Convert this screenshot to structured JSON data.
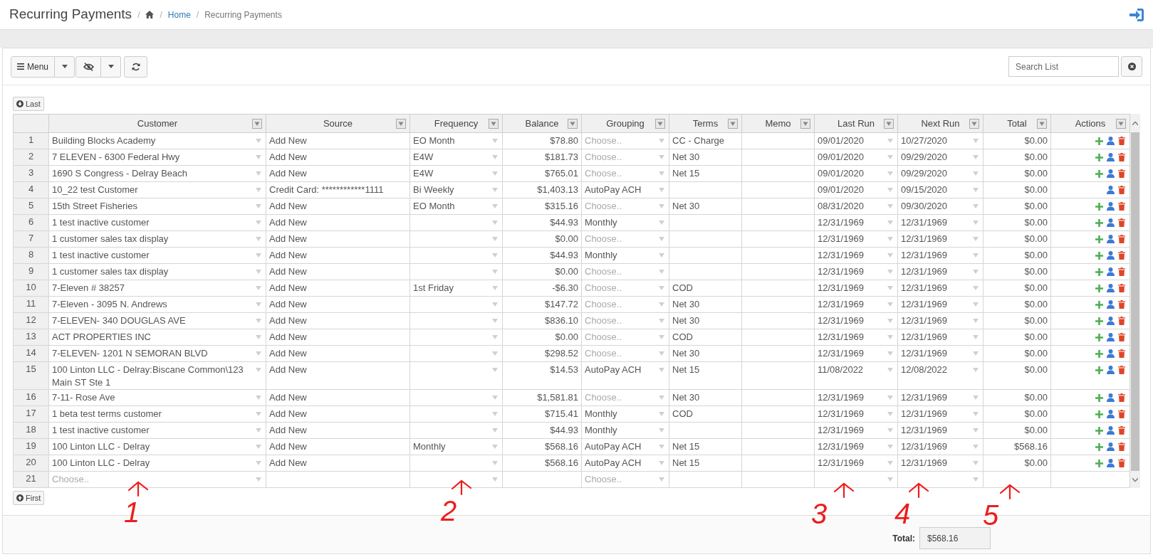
{
  "page": {
    "title": "Recurring Payments",
    "breadcrumb": [
      "Home",
      "Recurring Payments"
    ],
    "separators": [
      "/",
      "/",
      "/"
    ]
  },
  "toolbar": {
    "menu_label": "Menu",
    "search": {
      "placeholder": "Search List"
    }
  },
  "nav_top": "Last",
  "nav_bottom": "First",
  "table": {
    "columns": [
      "Customer",
      "Source",
      "Frequency",
      "Balance",
      "Grouping",
      "Terms",
      "Memo",
      "Last Run",
      "Next Run",
      "Total",
      "Actions"
    ],
    "rows": [
      {
        "num": "1",
        "customer": "Building Blocks Academy",
        "source": "Add New",
        "frequency": "EO Month",
        "balance": "$78.80",
        "grouping_placeholder": "Choose..",
        "terms": "CC - Charge",
        "last_run": "09/01/2020",
        "next_run": "10/27/2020",
        "total": "$0.00",
        "can_add": true
      },
      {
        "num": "2",
        "customer": "7 ELEVEN - 6300 Federal Hwy",
        "source": "Add New",
        "frequency": "E4W",
        "balance": "$181.73",
        "grouping_placeholder": "Choose..",
        "terms": "Net 30",
        "last_run": "09/01/2020",
        "next_run": "09/29/2020",
        "total": "$0.00",
        "can_add": true
      },
      {
        "num": "3",
        "customer": "1690 S Congress - Delray Beach",
        "source": "Add New",
        "frequency": "E4W",
        "balance": "$765.01",
        "grouping_placeholder": "Choose..",
        "terms": "Net 15",
        "last_run": "09/01/2020",
        "next_run": "09/29/2020",
        "total": "$0.00",
        "can_add": true
      },
      {
        "num": "4",
        "customer": "10_22 test Customer",
        "source": "Credit Card: ************1111",
        "frequency": "Bi Weekly",
        "balance": "$1,403.13",
        "grouping": "AutoPay ACH",
        "last_run": "09/01/2020",
        "next_run": "09/15/2020",
        "total": "$0.00",
        "can_add": false
      },
      {
        "num": "5",
        "customer": "15th Street Fisheries",
        "source": "Add New",
        "frequency": "EO Month",
        "balance": "$315.16",
        "grouping_placeholder": "Choose..",
        "terms": "Net 30",
        "last_run": "08/31/2020",
        "next_run": "09/30/2020",
        "total": "$0.00",
        "can_add": true
      },
      {
        "num": "6",
        "customer": "1 test inactive customer",
        "source": "Add New",
        "balance": "$44.93",
        "grouping": "Monthly",
        "last_run": "12/31/1969",
        "next_run": "12/31/1969",
        "total": "$0.00",
        "can_add": true
      },
      {
        "num": "7",
        "customer": "1 customer sales tax display",
        "source": "Add New",
        "balance": "$0.00",
        "grouping_placeholder": "Choose..",
        "last_run": "12/31/1969",
        "next_run": "12/31/1969",
        "total": "$0.00",
        "can_add": true
      },
      {
        "num": "8",
        "customer": "1 test inactive customer",
        "source": "Add New",
        "balance": "$44.93",
        "grouping": "Monthly",
        "last_run": "12/31/1969",
        "next_run": "12/31/1969",
        "total": "$0.00",
        "can_add": true
      },
      {
        "num": "9",
        "customer": "1 customer sales tax display",
        "source": "Add New",
        "balance": "$0.00",
        "grouping_placeholder": "Choose..",
        "last_run": "12/31/1969",
        "next_run": "12/31/1969",
        "total": "$0.00",
        "can_add": true
      },
      {
        "num": "10",
        "customer": "7-Eleven # 38257",
        "source": "Add New",
        "frequency": "1st Friday",
        "balance": "-$6.30",
        "grouping_placeholder": "Choose..",
        "terms": "COD",
        "last_run": "12/31/1969",
        "next_run": "12/31/1969",
        "total": "$0.00",
        "can_add": true
      },
      {
        "num": "11",
        "customer": "7-Eleven - 3095 N. Andrews",
        "source": "Add New",
        "balance": "$147.72",
        "grouping_placeholder": "Choose..",
        "terms": "Net 30",
        "last_run": "12/31/1969",
        "next_run": "12/31/1969",
        "total": "$0.00",
        "can_add": true
      },
      {
        "num": "12",
        "customer": "7-ELEVEN- 340 DOUGLAS AVE",
        "source": "Add New",
        "balance": "$836.10",
        "grouping_placeholder": "Choose..",
        "terms": "Net 30",
        "last_run": "12/31/1969",
        "next_run": "12/31/1969",
        "total": "$0.00",
        "can_add": true
      },
      {
        "num": "13",
        "customer": "ACT PROPERTIES INC",
        "source": "Add New",
        "balance": "$0.00",
        "grouping_placeholder": "Choose..",
        "terms": "COD",
        "last_run": "12/31/1969",
        "next_run": "12/31/1969",
        "total": "$0.00",
        "can_add": true
      },
      {
        "num": "14",
        "customer": "7-ELEVEN- 1201 N SEMORAN BLVD",
        "source": "Add New",
        "balance": "$298.52",
        "grouping_placeholder": "Choose..",
        "terms": "Net 30",
        "last_run": "12/31/1969",
        "next_run": "12/31/1969",
        "total": "$0.00",
        "can_add": true
      },
      {
        "num": "15",
        "customer": "100 Linton LLC - Delray:Biscane Common\\123 Main ST Ste 1",
        "source": "Add New",
        "balance": "$14.53",
        "grouping": "AutoPay ACH",
        "terms": "Net 15",
        "last_run": "11/08/2022",
        "next_run": "12/08/2022",
        "total": "$0.00",
        "can_add": true
      },
      {
        "num": "16",
        "customer": "7-11- Rose Ave",
        "source": "Add New",
        "balance": "$1,581.81",
        "grouping_placeholder": "Choose..",
        "terms": "Net 30",
        "last_run": "12/31/1969",
        "next_run": "12/31/1969",
        "total": "$0.00",
        "can_add": true
      },
      {
        "num": "17",
        "customer": "1 beta test terms customer",
        "source": "Add New",
        "balance": "$715.41",
        "grouping": "Monthly",
        "terms": "COD",
        "last_run": "12/31/1969",
        "next_run": "12/31/1969",
        "total": "$0.00",
        "can_add": true
      },
      {
        "num": "18",
        "customer": "1 test inactive customer",
        "source": "Add New",
        "balance": "$44.93",
        "grouping": "Monthly",
        "last_run": "12/31/1969",
        "next_run": "12/31/1969",
        "total": "$0.00",
        "can_add": true
      },
      {
        "num": "19",
        "customer": "100 Linton LLC - Delray",
        "source": "Add New",
        "frequency": "Monthly",
        "balance": "$568.16",
        "grouping": "AutoPay ACH",
        "terms": "Net 15",
        "last_run": "12/31/1969",
        "next_run": "12/31/1969",
        "total": "$568.16",
        "can_add": true
      },
      {
        "num": "20",
        "customer": "100 Linton LLC - Delray",
        "source": "Add New",
        "balance": "$568.16",
        "grouping": "AutoPay ACH",
        "terms": "Net 15",
        "last_run": "12/31/1969",
        "next_run": "12/31/1969",
        "total": "$0.00",
        "can_add": true
      },
      {
        "num": "21",
        "customer_placeholder": "Choose..",
        "grouping_placeholder": "Choose..",
        "new_row": true
      }
    ]
  },
  "footer": {
    "total_label": "Total:",
    "total_value": "$568.16"
  },
  "annotations": [
    {
      "label": "1"
    },
    {
      "label": "2"
    },
    {
      "label": "3"
    },
    {
      "label": "4"
    },
    {
      "label": "5"
    }
  ]
}
